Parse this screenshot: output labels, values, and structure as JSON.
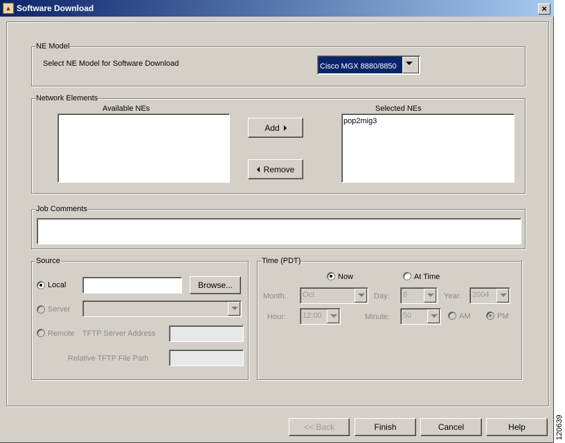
{
  "window": {
    "title": "Software Download",
    "close_glyph": "×"
  },
  "ne_model": {
    "legend": "NE Model",
    "prompt": "Select NE Model for Software Download",
    "selected": "Cisco MGX 8880/8850"
  },
  "network_elements": {
    "legend": "Network Elements",
    "available_header": "Available NEs",
    "available_items": [],
    "selected_header": "Selected NEs",
    "selected_items": [
      "pop2mig3"
    ],
    "add_label": "Add",
    "remove_label": "Remove"
  },
  "job_comments": {
    "legend": "Job Comments",
    "value": ""
  },
  "source": {
    "legend": "Source",
    "local_label": "Local",
    "local_value": "",
    "browse_label": "Browse...",
    "server_label": "Server",
    "server_value": "",
    "remote_label": "Remote",
    "tftp_address_label": "TFTP Server Address",
    "tftp_address_value": "",
    "tftp_path_label": "Relative TFTP File Path",
    "tftp_path_value": ""
  },
  "time": {
    "legend": "Time (PDT)",
    "now_label": "Now",
    "at_time_label": "At Time",
    "month_label": "Month:",
    "month_value": "Oct",
    "day_label": "Day:",
    "day_value": "8",
    "year_label": "Year:",
    "year_value": "2004",
    "hour_label": "Hour:",
    "hour_value": "12:00",
    "minute_label": "Minute:",
    "minute_value": "50",
    "am_label": "AM",
    "pm_label": "PM"
  },
  "footer": {
    "back_label": "<< Back",
    "finish_label": "Finish",
    "cancel_label": "Cancel",
    "help_label": "Help"
  },
  "figure_id": "120639"
}
